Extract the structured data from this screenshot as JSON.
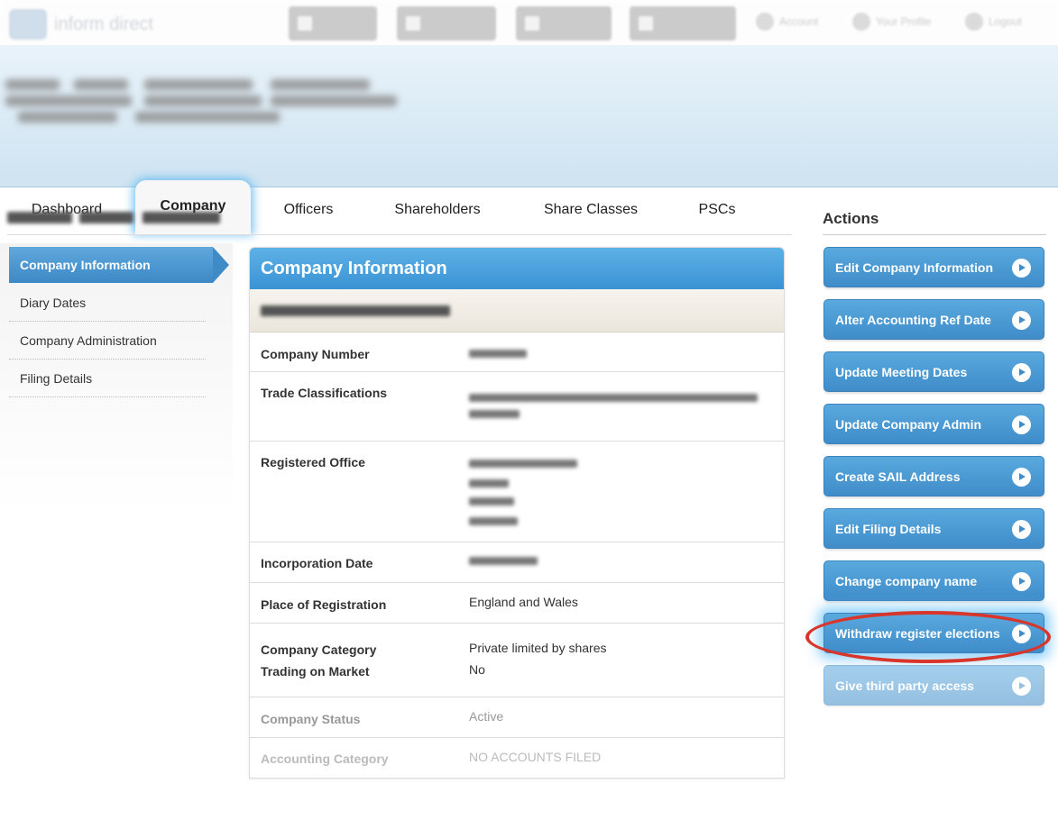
{
  "topbar": {
    "logo_text": "inform direct",
    "buttons": [
      "",
      "",
      "",
      ""
    ],
    "links": [
      {
        "label": "Account",
        "icon": "account-icon"
      },
      {
        "label": "Your Profile",
        "icon": "profile-icon"
      },
      {
        "label": "Logout",
        "icon": "logout-icon"
      }
    ]
  },
  "tabs": [
    {
      "label": "Dashboard",
      "active": false
    },
    {
      "label": "Company",
      "active": true
    },
    {
      "label": "Officers",
      "active": false
    },
    {
      "label": "Shareholders",
      "active": false
    },
    {
      "label": "Share Classes",
      "active": false
    },
    {
      "label": "PSCs",
      "active": false
    }
  ],
  "sidebar": {
    "items": [
      {
        "label": "Company Information",
        "active": true
      },
      {
        "label": "Diary Dates",
        "active": false
      },
      {
        "label": "Company Administration",
        "active": false
      },
      {
        "label": "Filing Details",
        "active": false
      }
    ]
  },
  "panel": {
    "title": "Company Information",
    "rows": [
      {
        "label": "Company Number",
        "value": ""
      },
      {
        "label": "Trade Classifications",
        "value": ""
      },
      {
        "label": "Registered Office",
        "value": ""
      },
      {
        "label": "Incorporation Date",
        "value": ""
      },
      {
        "label": "Place of Registration",
        "value": "England and Wales"
      },
      {
        "label": "Company Category",
        "value": "Private limited by shares"
      },
      {
        "label": "Trading on Market",
        "value": "No"
      },
      {
        "label": "Company Status",
        "value": "Active"
      },
      {
        "label": "Accounting Category",
        "value": "NO ACCOUNTS FILED"
      }
    ]
  },
  "actions": {
    "title": "Actions",
    "buttons": [
      {
        "label": "Edit Company Information"
      },
      {
        "label": "Alter Accounting Ref Date"
      },
      {
        "label": "Update Meeting Dates"
      },
      {
        "label": "Update Company Admin"
      },
      {
        "label": "Create SAIL Address"
      },
      {
        "label": "Edit Filing Details"
      },
      {
        "label": "Change company name"
      },
      {
        "label": "Withdraw register elections"
      },
      {
        "label": "Give third party access"
      }
    ]
  },
  "colors": {
    "accent": "#3f8cc9",
    "highlight_ring": "#d9362b",
    "header_bg": "#d6e8f4"
  }
}
